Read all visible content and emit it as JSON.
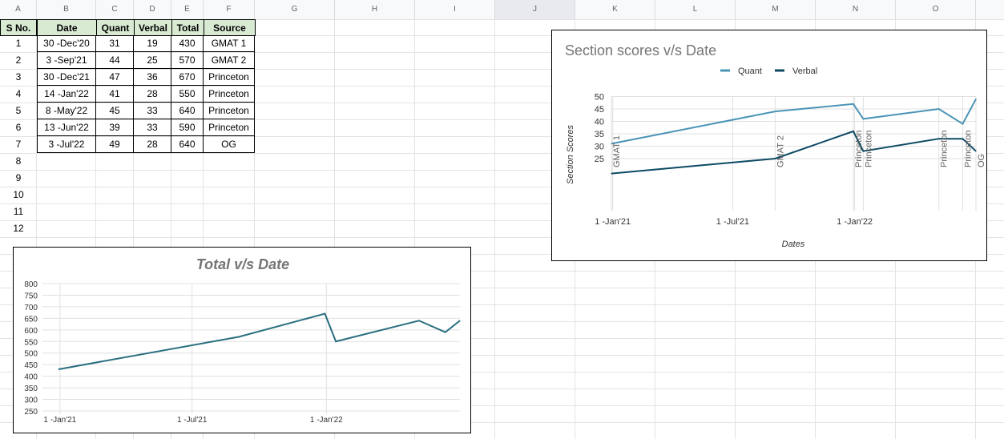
{
  "columns": [
    "A",
    "B",
    "C",
    "D",
    "E",
    "F",
    "G",
    "H",
    "I",
    "J",
    "K",
    "L",
    "M",
    "N",
    "O"
  ],
  "table": {
    "headers": [
      "S No.",
      "Date",
      "Quant",
      "Verbal",
      "Total",
      "Source"
    ],
    "rows": [
      [
        "1",
        "30 -Dec'20",
        "31",
        "19",
        "430",
        "GMAT 1"
      ],
      [
        "2",
        "3 -Sep'21",
        "44",
        "25",
        "570",
        "GMAT 2"
      ],
      [
        "3",
        "30 -Dec'21",
        "47",
        "36",
        "670",
        "Princeton"
      ],
      [
        "4",
        "14 -Jan'22",
        "41",
        "28",
        "550",
        "Princeton"
      ],
      [
        "5",
        "8 -May'22",
        "45",
        "33",
        "640",
        "Princeton"
      ],
      [
        "6",
        "13 -Jun'22",
        "39",
        "33",
        "590",
        "Princeton"
      ],
      [
        "7",
        "3 -Jul'22",
        "49",
        "28",
        "640",
        "OG"
      ]
    ],
    "extra_row_numbers": [
      "8",
      "9",
      "10",
      "11",
      "12"
    ]
  },
  "colors": {
    "quant": "#4a94b6",
    "verbal": "#0c4a63",
    "total": "#2a6f80",
    "header_fill": "#d9ead3"
  },
  "chart_data": [
    {
      "type": "line",
      "title": "Total v/s Date",
      "xlabel": "",
      "ylabel": "",
      "x_tick_labels": [
        "1 -Jan'21",
        "1 -Jul'21",
        "1 -Jan'22"
      ],
      "x_tick_dates": [
        "2021-01-01",
        "2021-07-01",
        "2022-01-01"
      ],
      "x_range": [
        "2020-12-30",
        "2022-07-03"
      ],
      "ylim": [
        250,
        800
      ],
      "y_ticks": [
        800,
        750,
        700,
        650,
        600,
        550,
        500,
        450,
        400,
        350,
        300,
        250
      ],
      "grid": true,
      "series": [
        {
          "dates": [
            "2020-12-30",
            "2021-09-03",
            "2021-12-30",
            "2022-01-14",
            "2022-05-08",
            "2022-06-13",
            "2022-07-03"
          ],
          "values": [
            430,
            570,
            670,
            550,
            640,
            590,
            640
          ]
        }
      ]
    },
    {
      "type": "line",
      "title": "Section scores v/s Date",
      "xlabel": "Dates",
      "ylabel": "Section Scores",
      "legend": "top",
      "x_tick_labels": [
        "1 -Jan'21",
        "1 -Jul'21",
        "1 -Jan'22"
      ],
      "x_tick_dates": [
        "2021-01-01",
        "2021-07-01",
        "2022-01-01"
      ],
      "x_range": [
        "2020-12-30",
        "2022-07-03"
      ],
      "y_ticks": [
        50,
        45,
        40,
        35,
        30,
        25
      ],
      "grid": true,
      "annotation_labels": [
        "GMAT 1",
        "GMAT 2",
        "Princeton",
        "Princeton",
        "Princeton",
        "Princeton",
        "OG"
      ],
      "series": [
        {
          "name": "Quant",
          "dates": [
            "2020-12-30",
            "2021-09-03",
            "2021-12-30",
            "2022-01-14",
            "2022-05-08",
            "2022-06-13",
            "2022-07-03"
          ],
          "values": [
            31,
            44,
            47,
            41,
            45,
            39,
            49
          ]
        },
        {
          "name": "Verbal",
          "dates": [
            "2020-12-30",
            "2021-09-03",
            "2021-12-30",
            "2022-01-14",
            "2022-05-08",
            "2022-06-13",
            "2022-07-03"
          ],
          "values": [
            19,
            25,
            36,
            28,
            33,
            33,
            28
          ]
        }
      ]
    }
  ]
}
